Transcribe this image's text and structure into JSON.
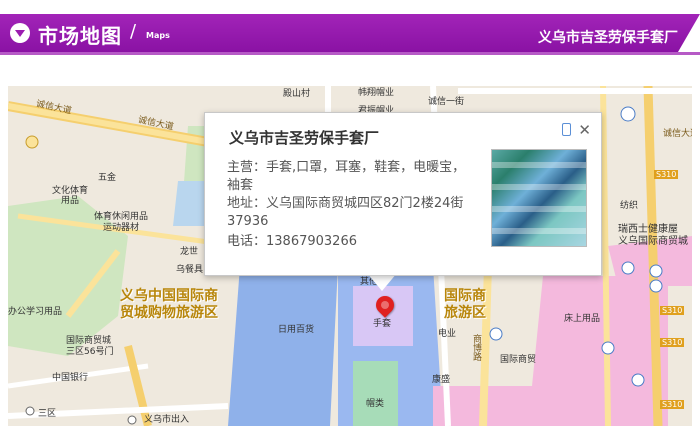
{
  "header": {
    "title": "市场地图",
    "subtitle": "Maps",
    "company": "义乌市吉圣劳保手套厂",
    "colors": {
      "bar": "#9b1cb0",
      "text": "#ffffff"
    }
  },
  "map": {
    "labels": {
      "chengxin1": "诚信大道",
      "chengxin2": "诚信大道",
      "chengxin_right": "诚信大道",
      "chengxin_yijie": "诚信一街",
      "wujin": "五金",
      "wenhua": "文化体育\n用品",
      "tiyu": "体育休闲用品\n运动器材",
      "long": "龙世",
      "wucan": "乌餐具",
      "big1": "义乌中国国际商\n贸城购物旅游区",
      "big2": "国际商\n旅游区",
      "bangong": "办公学习用品",
      "guoji": "国际商贸城\n三区56号门",
      "zhongguo": "中国银行",
      "sanqu": "三区",
      "chuxin": "义乌市出入",
      "riyong": "日用百货",
      "fulei": "帽类",
      "jie": "手套",
      "shangbo": "商博路",
      "dian": "电业",
      "guoji_right": "国际商贸",
      "kangsheng": "康盛",
      "chuangshang": "床上用品",
      "ruixi": "瑞西士健康屋\n义乌国际商贸城",
      "fangzhi": "纺织",
      "s310a": "S310",
      "s310b": "S310",
      "s310c": "S310",
      "s310d": "S310",
      "junxiang": "帏翔帽业",
      "junsu": "君振帽业",
      "dianshancun": "殿山村",
      "qita": "其他针"
    }
  },
  "popup": {
    "title": "义乌市吉圣劳保手套厂",
    "business": "主营：手套,口罩，耳塞，鞋套，电暖宝，\n袖套",
    "address": "地址：义乌国际商贸城四区82门2楼24街\n37936",
    "phone": "电话：13867903266",
    "close": "✕"
  }
}
